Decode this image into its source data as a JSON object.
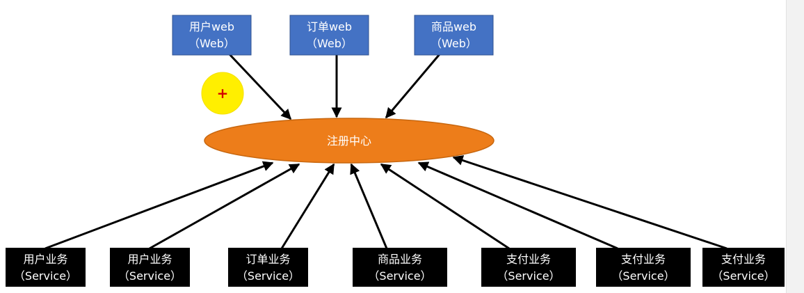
{
  "diagram": {
    "center": {
      "label": "注册中心"
    },
    "web_nodes": [
      {
        "line1": "用户web",
        "line2": "（Web）"
      },
      {
        "line1": "订单web",
        "line2": "（Web）"
      },
      {
        "line1": "商品web",
        "line2": "（Web）"
      }
    ],
    "service_nodes": [
      {
        "line1": "用户业务",
        "line2": "（Service）"
      },
      {
        "line1": "用户业务",
        "line2": "（Service）"
      },
      {
        "line1": "订单业务",
        "line2": "（Service）"
      },
      {
        "line1": "商品业务",
        "line2": "（Service）"
      },
      {
        "line1": "支付业务",
        "line2": "（Service）"
      },
      {
        "line1": "支付业务",
        "line2": "（Service）"
      },
      {
        "line1": "支付业务",
        "line2": "（Service）"
      }
    ],
    "cursor_marker": {
      "symbol": "+"
    }
  },
  "colors": {
    "web_box": "#4472c4",
    "web_box_border": "#2f528f",
    "service_box": "#000000",
    "center_fill": "#ed7d1a",
    "center_border": "#c7660e",
    "arrow": "#000000",
    "cursor_fill": "#ffef00",
    "cursor_plus": "#d40000"
  }
}
